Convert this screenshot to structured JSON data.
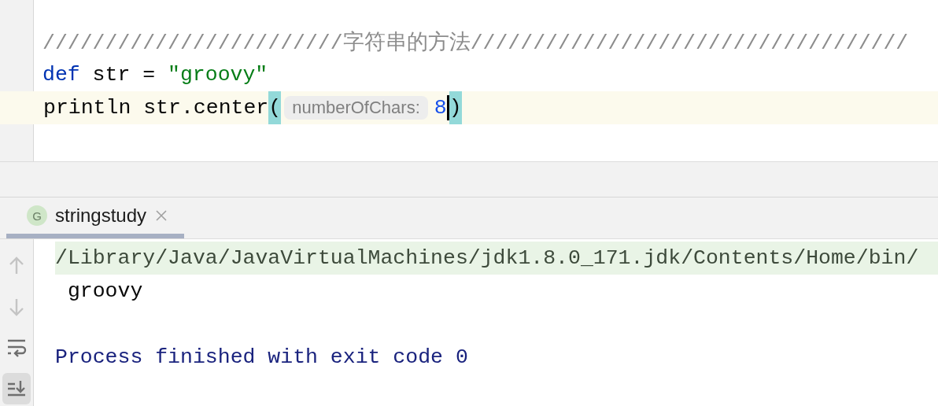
{
  "editor": {
    "lines": [
      {
        "tokens": [
          {
            "kind": "comment",
            "text": "////////////////////////字符串的方法///////////////////////////////////"
          }
        ]
      },
      {
        "tokens": [
          {
            "kind": "keyword",
            "text": "def"
          },
          {
            "kind": "plain",
            "text": " str = "
          },
          {
            "kind": "string",
            "text": "\"groovy\""
          }
        ]
      },
      {
        "current": true,
        "tokens": [
          {
            "kind": "plain",
            "text": "println str.center"
          },
          {
            "kind": "brace",
            "text": "("
          },
          {
            "kind": "hint",
            "text": "numberOfChars:"
          },
          {
            "kind": "number",
            "text": "8"
          },
          {
            "kind": "brace",
            "text": ")",
            "caret": true
          }
        ]
      }
    ]
  },
  "run_panel": {
    "tabs": [
      {
        "label": "stringstudy",
        "badge": "G",
        "selected": true
      }
    ],
    "toolbar": [
      {
        "kind": "up",
        "selected": false
      },
      {
        "kind": "down",
        "selected": false
      },
      {
        "kind": "wrap",
        "selected": false
      },
      {
        "kind": "scroll-end",
        "selected": true
      }
    ],
    "console": [
      {
        "kind": "command",
        "text": "/Library/Java/JavaVirtualMachines/jdk1.8.0_171.jdk/Contents/Home/bin/"
      },
      {
        "kind": "output",
        "text": " groovy"
      },
      {
        "kind": "blank"
      },
      {
        "kind": "system",
        "text": "Process finished with exit code 0"
      }
    ]
  }
}
